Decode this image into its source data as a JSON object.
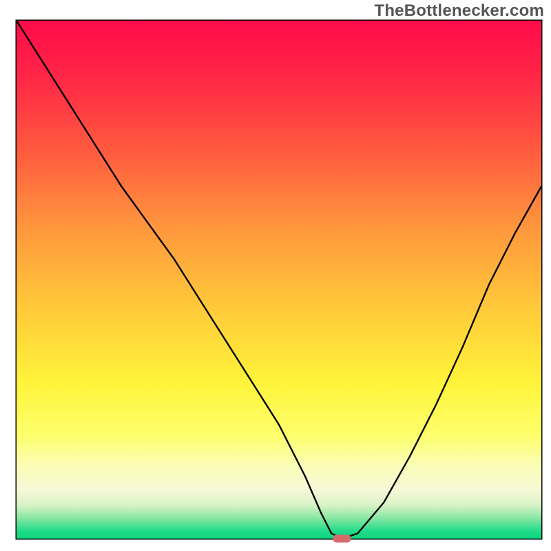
{
  "watermark": "TheBottlenecker.com",
  "chart_data": {
    "type": "line",
    "title": "",
    "xlabel": "",
    "ylabel": "",
    "xlim": [
      0,
      100
    ],
    "ylim": [
      0,
      100
    ],
    "series": [
      {
        "name": "bottleneck-curve",
        "x": [
          0,
          5,
          10,
          15,
          20,
          25,
          30,
          35,
          40,
          45,
          50,
          55,
          58,
          60,
          62,
          65,
          70,
          75,
          80,
          85,
          90,
          95,
          100
        ],
        "y": [
          100,
          92,
          84,
          76,
          68,
          61,
          54,
          46,
          38,
          30,
          22,
          12,
          5,
          1,
          0,
          1,
          7,
          16,
          26,
          37,
          49,
          59,
          68
        ]
      }
    ],
    "marker": {
      "x_center": 62,
      "y_center": 0,
      "width": 3.5,
      "height": 1.5,
      "color": "#d46c6c"
    },
    "background_gradient": {
      "stops": [
        {
          "offset": 0.0,
          "color": "#ff0a4a"
        },
        {
          "offset": 0.12,
          "color": "#ff2a46"
        },
        {
          "offset": 0.25,
          "color": "#ff5a3f"
        },
        {
          "offset": 0.4,
          "color": "#ff973d"
        },
        {
          "offset": 0.55,
          "color": "#ffc83a"
        },
        {
          "offset": 0.7,
          "color": "#fff43a"
        },
        {
          "offset": 0.8,
          "color": "#fdfe6b"
        },
        {
          "offset": 0.86,
          "color": "#fbfdb7"
        },
        {
          "offset": 0.905,
          "color": "#f7f8d7"
        },
        {
          "offset": 0.935,
          "color": "#d9f3c6"
        },
        {
          "offset": 0.96,
          "color": "#8ae7a4"
        },
        {
          "offset": 0.985,
          "color": "#22dc8a"
        },
        {
          "offset": 1.0,
          "color": "#0cd481"
        }
      ]
    },
    "axis_color": "#000000",
    "curve_color": "#000000",
    "curve_width": 2.4
  }
}
